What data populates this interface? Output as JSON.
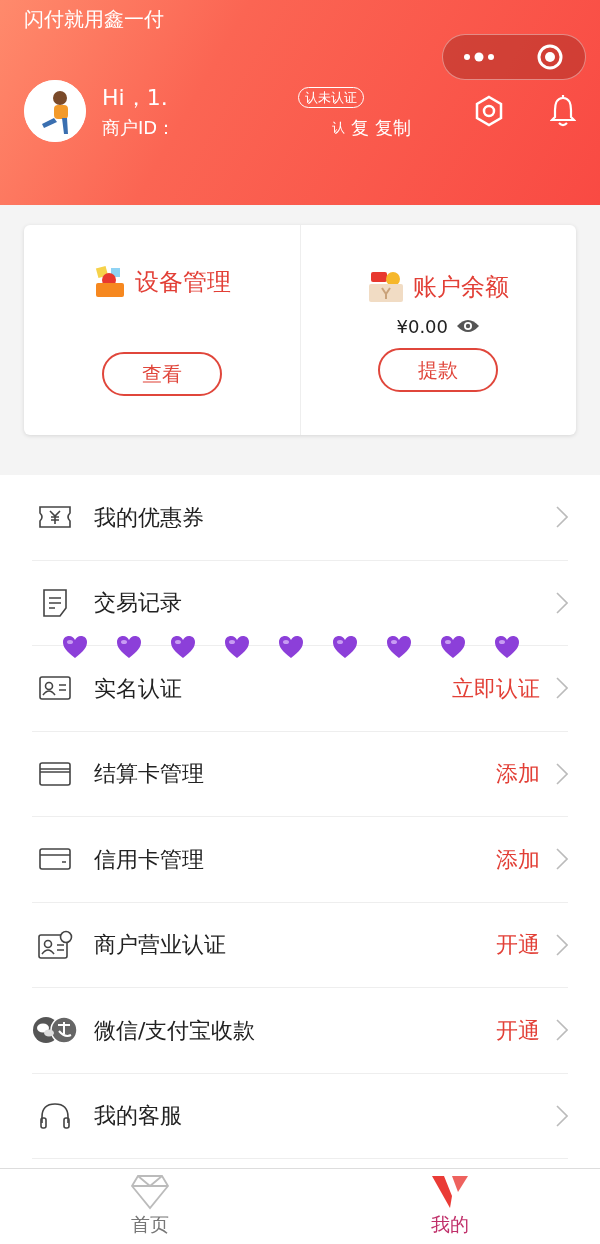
{
  "header": {
    "slogan": "闪付就用鑫一付",
    "greeting": "Hi，1.",
    "badge": "认未认证",
    "merchant_label": "商户ID：",
    "fragment_1": "认",
    "fragment_2": "复",
    "copy": "复制"
  },
  "cards": [
    {
      "kind": "device",
      "title": "设备管理",
      "button": "查看"
    },
    {
      "kind": "balance",
      "title": "账户余额",
      "amount": "¥0.00",
      "button": "提款"
    }
  ],
  "menu": [
    {
      "kind": "coupon",
      "label": "我的优惠券"
    },
    {
      "kind": "receipt",
      "label": "交易记录"
    },
    {
      "kind": "idcard",
      "label": "实名认证",
      "action": "立即认证"
    },
    {
      "kind": "bankcard",
      "label": "结算卡管理",
      "action": "添加"
    },
    {
      "kind": "creditcard",
      "label": "信用卡管理",
      "action": "添加"
    },
    {
      "kind": "license",
      "label": "商户营业认证",
      "action": "开通"
    },
    {
      "kind": "pay",
      "label": "微信/支付宝收款",
      "action": "开通"
    },
    {
      "kind": "headset",
      "label": "我的客服"
    }
  ],
  "tabs": [
    {
      "kind": "home",
      "label": "首页",
      "selected": false
    },
    {
      "kind": "mine",
      "label": "我的",
      "selected": true
    }
  ]
}
